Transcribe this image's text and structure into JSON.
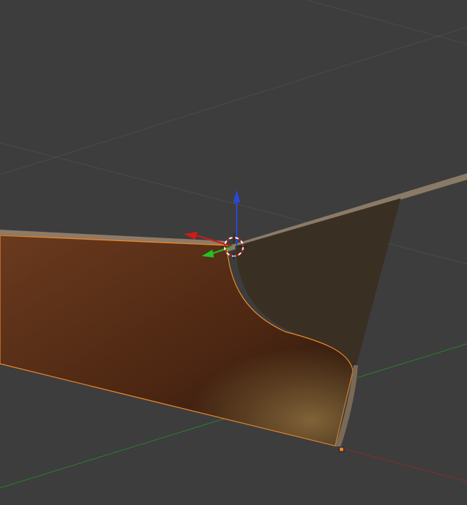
{
  "viewport": {
    "background": "#3d3d3d",
    "grid_color": "#4a4a4a",
    "x_axis_color": "#8b2a2a",
    "y_axis_color": "#2e7d2e"
  },
  "object": {
    "selected_outline_color": "#f08a2a",
    "side_color": "#5b2f16",
    "front_color": "#3a2f23",
    "rim_color": "#8a7a68"
  },
  "gizmo": {
    "z_color": "#2a47d6",
    "x_color": "#d11a1a",
    "y_color": "#22c322"
  },
  "cursor_3d": {
    "ring_colors": [
      "#ffffff",
      "#d11a1a"
    ]
  }
}
